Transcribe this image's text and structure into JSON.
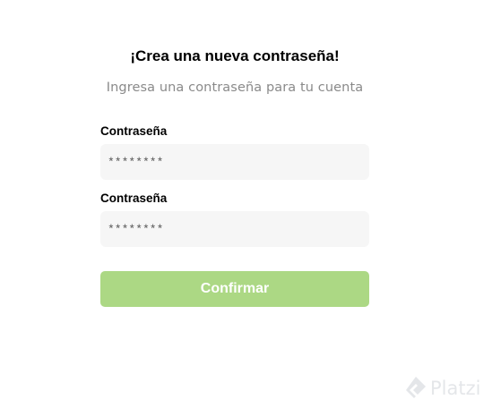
{
  "heading": "¡Crea una nueva contraseña!",
  "subheading": "Ingresa una contraseña para tu cuenta",
  "fields": [
    {
      "label": "Contraseña",
      "placeholder": "********"
    },
    {
      "label": "Contraseña",
      "placeholder": "********"
    }
  ],
  "confirm_label": "Confirmar",
  "watermark": {
    "text": "Platzi",
    "icon": "platzi-logo-icon"
  },
  "colors": {
    "button": "#acd884",
    "field_bg": "#f6f6f6",
    "subtitle": "#8a8a8a"
  }
}
